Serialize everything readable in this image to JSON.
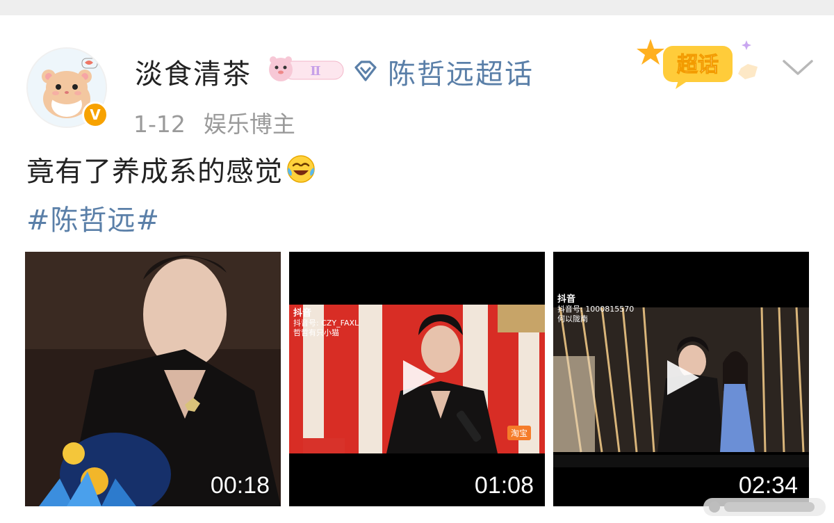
{
  "post": {
    "username": "淡食清茶",
    "member_level": "Ⅱ",
    "super_topic": "陈哲远超话",
    "super_topic_sticker": "超话",
    "time": "1-12",
    "role": "娱乐博主",
    "text": "竟有了养成系的感觉",
    "hashtag": "#陈哲远#"
  },
  "icons": {
    "avatar": "hamster-avatar-icon",
    "verified": "verified-v-icon",
    "super_topic": "diamond-icon",
    "more": "chevron-down-icon",
    "emoji": "laugh-cry-emoji-icon",
    "play": "play-icon"
  },
  "videos": [
    {
      "duration": "00:18"
    },
    {
      "duration": "01:08",
      "platform": "抖音",
      "account": "抖音号: CZY_FAXL",
      "note": "哲哲有只小猫",
      "tag": "淘宝"
    },
    {
      "duration": "02:34",
      "platform": "抖音",
      "account": "抖音号: 1000815570",
      "note": "何以陇南"
    }
  ],
  "colors": {
    "link": "#5a7fa8",
    "verified": "#f7a200",
    "meta": "#9a9a9a"
  }
}
